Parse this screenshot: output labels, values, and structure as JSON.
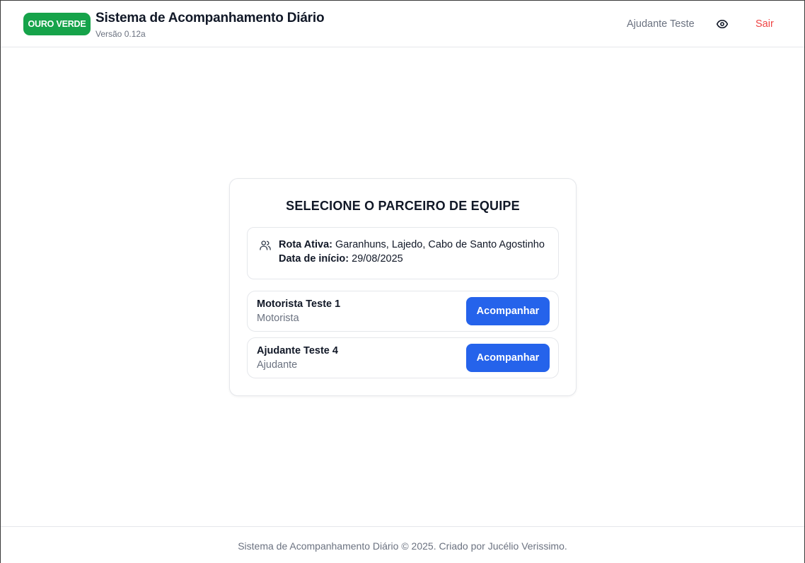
{
  "header": {
    "brand": "OURO VERDE",
    "title": "Sistema de Acompanhamento Diário",
    "version": "Versão 0.12a",
    "user": "Ajudante Teste",
    "view_icon": "eye-icon",
    "logout_label": "Sair"
  },
  "card": {
    "title": "SELECIONE O PARCEIRO DE EQUIPE",
    "route_icon": "users-icon",
    "route_label": "Rota Ativa:",
    "route_value": "Garanhuns, Lajedo, Cabo de Santo Agostinho",
    "start_label": "Data de início:",
    "start_value": "29/08/2025",
    "partners": [
      {
        "name": "Motorista Teste 1",
        "role": "Motorista",
        "action": "Acompanhar"
      },
      {
        "name": "Ajudante Teste 4",
        "role": "Ajudante",
        "action": "Acompanhar"
      }
    ]
  },
  "footer": {
    "text": "Sistema de Acompanhamento Diário © 2025. Criado por Jucélio Verissimo."
  },
  "colors": {
    "brand": "#16a34a",
    "primary": "#2563eb",
    "danger": "#ef4444",
    "muted": "#6b7280"
  }
}
